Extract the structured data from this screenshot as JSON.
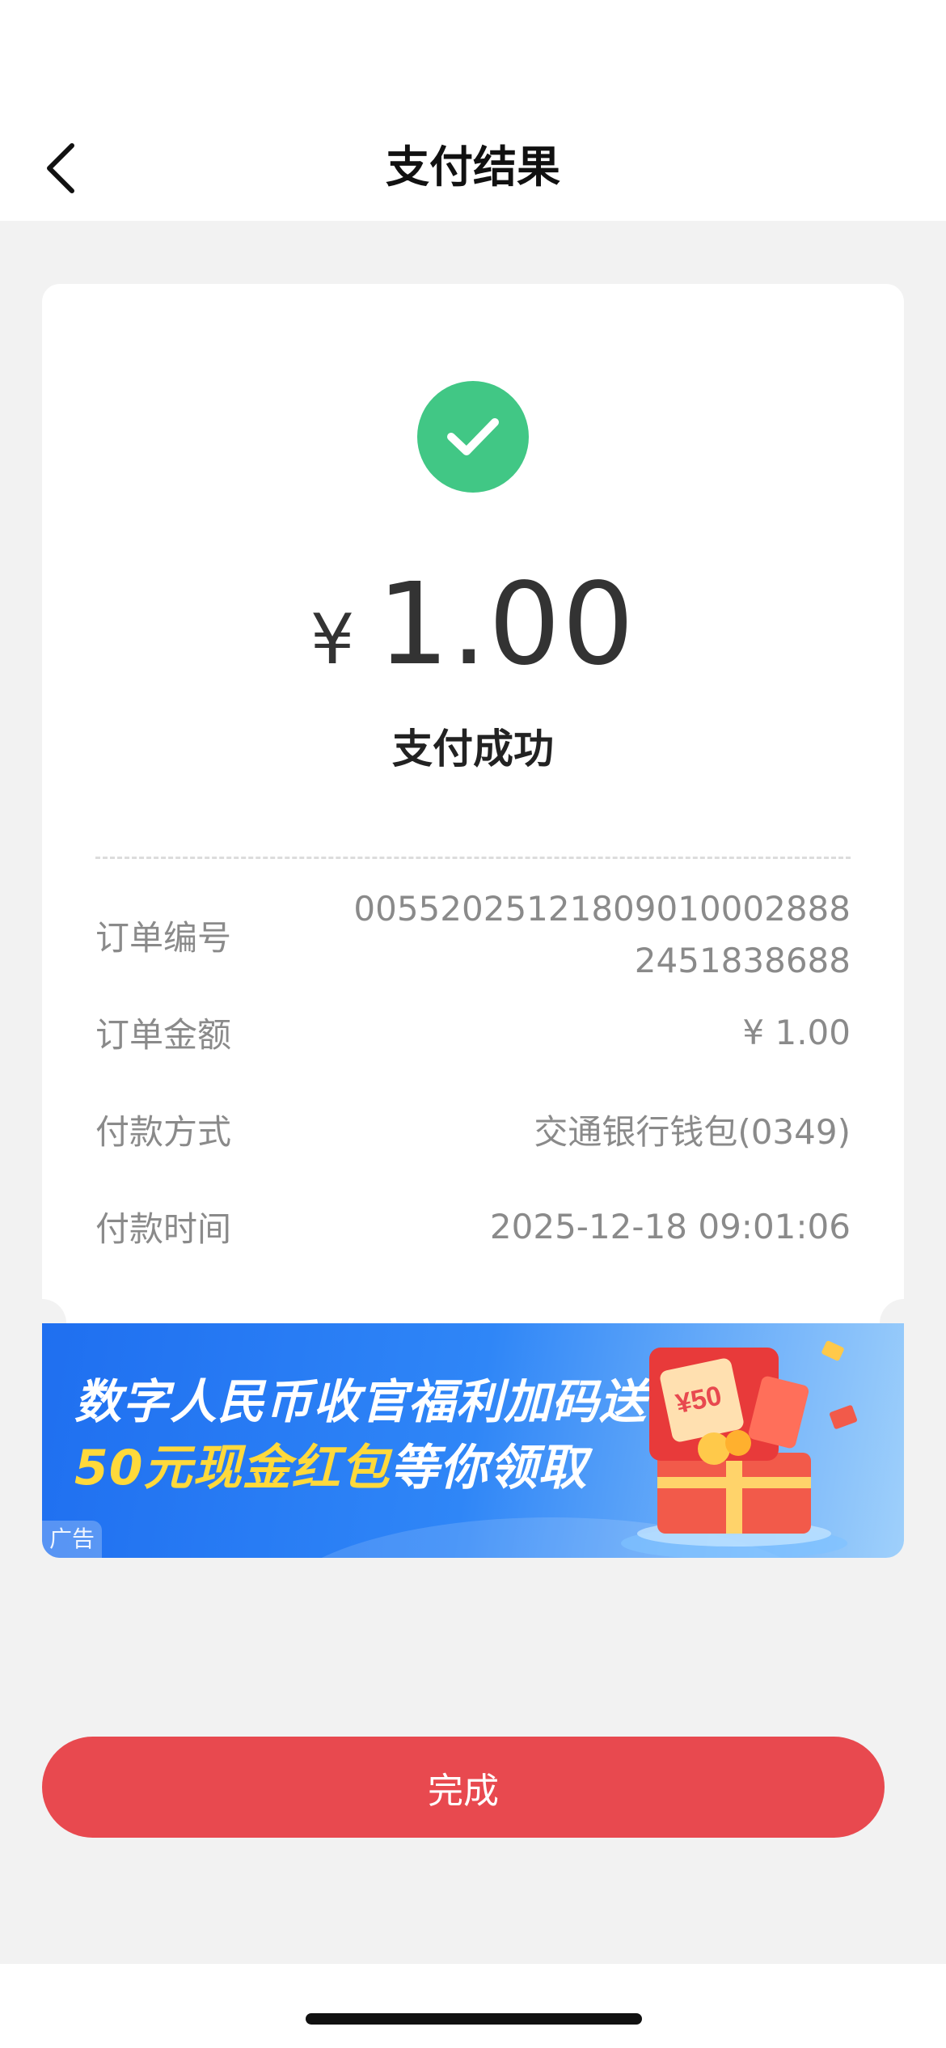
{
  "header": {
    "title": "支付结果",
    "back_icon": "chevron-left-icon"
  },
  "result": {
    "status_icon": "check-circle-icon",
    "status_color": "#41c785",
    "currency": "¥",
    "amount": "1.00",
    "status_text": "支付成功"
  },
  "details": {
    "order_no_label": "订单编号",
    "order_no_line1": "00552025121809010002888",
    "order_no_line2": "2451838688",
    "amount_label": "订单金额",
    "amount_value": "¥ 1.00",
    "method_label": "付款方式",
    "method_value": "交通银行钱包(0349)",
    "time_label": "付款时间",
    "time_value": "2025-12-18 09:01:06"
  },
  "banner": {
    "line1": "数字人民币收官福利加码送",
    "line2_highlight": "50元现金红包",
    "line2_rest": "等你领取",
    "ad_tag": "广告",
    "gift_text": "¥50"
  },
  "actions": {
    "done_label": "完成",
    "accent_color": "#e8494f"
  }
}
